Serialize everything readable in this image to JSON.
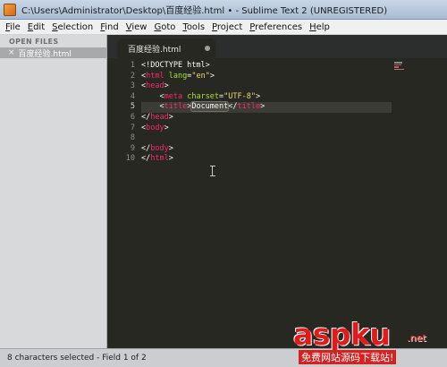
{
  "window": {
    "title": "C:\\Users\\Administrator\\Desktop\\百度经验.html • - Sublime Text 2 (UNREGISTERED)"
  },
  "menu": [
    "File",
    "Edit",
    "Selection",
    "Find",
    "View",
    "Goto",
    "Tools",
    "Project",
    "Preferences",
    "Help"
  ],
  "sidebar": {
    "heading": "OPEN FILES",
    "file": "百度经验.html",
    "close_glyph": "×"
  },
  "tab": {
    "label": "百度经验.html"
  },
  "editor": {
    "current_line": 5,
    "line_numbers": [
      "1",
      "2",
      "3",
      "4",
      "5",
      "6",
      "7",
      "8",
      "9",
      "10"
    ],
    "lines": [
      {
        "indent": "",
        "segments": [
          [
            "punct",
            "<!DOCTYPE html>"
          ]
        ]
      },
      {
        "indent": "",
        "segments": [
          [
            "punct",
            "<"
          ],
          [
            "tag",
            "html"
          ],
          [
            "punct",
            " "
          ],
          [
            "attr",
            "lang"
          ],
          [
            "punct",
            "="
          ],
          [
            "str",
            "\"en\""
          ],
          [
            "punct",
            ">"
          ]
        ]
      },
      {
        "indent": "",
        "segments": [
          [
            "punct",
            "<"
          ],
          [
            "tag",
            "head"
          ],
          [
            "punct",
            ">"
          ]
        ]
      },
      {
        "indent": "    ",
        "segments": [
          [
            "punct",
            "<"
          ],
          [
            "tag",
            "meta"
          ],
          [
            "punct",
            " "
          ],
          [
            "attr",
            "charset"
          ],
          [
            "punct",
            "="
          ],
          [
            "str",
            "\"UTF-8\""
          ],
          [
            "punct",
            ">"
          ]
        ]
      },
      {
        "indent": "    ",
        "segments": [
          [
            "punct",
            "<"
          ],
          [
            "tag",
            "title"
          ],
          [
            "punct",
            ">"
          ],
          [
            "sel",
            "Document"
          ],
          [
            "punct",
            "</"
          ],
          [
            "tag",
            "title"
          ],
          [
            "punct",
            ">"
          ]
        ]
      },
      {
        "indent": "",
        "segments": [
          [
            "punct",
            "</"
          ],
          [
            "tag",
            "head"
          ],
          [
            "punct",
            ">"
          ]
        ]
      },
      {
        "indent": "",
        "segments": [
          [
            "punct",
            "<"
          ],
          [
            "tag",
            "body"
          ],
          [
            "punct",
            ">"
          ]
        ]
      },
      {
        "indent": "",
        "segments": []
      },
      {
        "indent": "",
        "segments": [
          [
            "punct",
            "</"
          ],
          [
            "tag",
            "body"
          ],
          [
            "punct",
            ">"
          ]
        ]
      },
      {
        "indent": "",
        "segments": [
          [
            "punct",
            "</"
          ],
          [
            "tag",
            "html"
          ],
          [
            "punct",
            ">"
          ]
        ]
      }
    ]
  },
  "status": {
    "text": "8 characters selected - Field 1 of 2",
    "right": "Ta"
  },
  "watermark": {
    "logo": "aspku",
    "net": ".net",
    "sub": "免费网站源码下载站!"
  },
  "colors": {
    "editor_bg": "#272822",
    "tag": "#f92672",
    "attr": "#a6e22e",
    "string": "#e6db74",
    "watermark_red": "#e01b1b"
  }
}
